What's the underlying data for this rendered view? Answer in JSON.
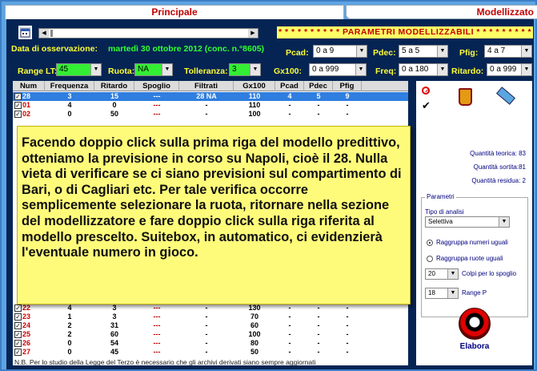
{
  "tabs": {
    "principale": "Principale",
    "modellizzato": "Modellizzato"
  },
  "header": {
    "param_title": "* * * * * * * * * * PARAMETRI MODELLIZZABILI * * * * * * * * *",
    "date_label": "Data di osservazione:",
    "date_value": "martedì 30 ottobre 2012 (conc. n.°8605)"
  },
  "controls": {
    "pcad": {
      "label": "Pcad:",
      "value": "0 a 9"
    },
    "pdec": {
      "label": "Pdec:",
      "value": "5 a 5"
    },
    "pfig": {
      "label": "Pfig:",
      "value": "4 a 7"
    },
    "range_lt": {
      "label": "Range LT:",
      "value": "45"
    },
    "ruota": {
      "label": "Ruota:",
      "value": "NA"
    },
    "tolleranza": {
      "label": "Tolleranza:",
      "value": "3"
    },
    "gx100": {
      "label": "Gx100:",
      "value": "0 a 999"
    },
    "freq": {
      "label": "Freq:",
      "value": "0 a 180"
    },
    "ritardo": {
      "label": "Ritardo:",
      "value": "0 a 999"
    }
  },
  "table": {
    "columns": [
      "Num",
      "Frequenza",
      "Ritardo",
      "Spoglio",
      "Filtrati",
      "Gx100",
      "Pcad",
      "Pdec",
      "Pfig"
    ],
    "top_rows": [
      {
        "num": "28",
        "freq": "3",
        "rit": "15",
        "spoglio": "---",
        "filtrati": "28 NA",
        "gx": "110",
        "pcad": "4",
        "pdec": "5",
        "pfig": "9",
        "selected": true
      },
      {
        "num": "01",
        "freq": "4",
        "rit": "0",
        "spoglio": "---",
        "filtrati": "-",
        "gx": "110",
        "pcad": "-",
        "pdec": "-",
        "pfig": "-",
        "selected": false
      },
      {
        "num": "02",
        "freq": "0",
        "rit": "50",
        "spoglio": "---",
        "filtrati": "-",
        "gx": "100",
        "pcad": "-",
        "pdec": "-",
        "pfig": "-",
        "selected": false
      }
    ],
    "bottom_rows": [
      {
        "num": "22",
        "freq": "4",
        "rit": "3",
        "spoglio": "---",
        "filtrati": "-",
        "gx": "130",
        "pcad": "-",
        "pdec": "-",
        "pfig": "-"
      },
      {
        "num": "23",
        "freq": "1",
        "rit": "3",
        "spoglio": "---",
        "filtrati": "-",
        "gx": "70",
        "pcad": "-",
        "pdec": "-",
        "pfig": "-"
      },
      {
        "num": "24",
        "freq": "2",
        "rit": "31",
        "spoglio": "---",
        "filtrati": "-",
        "gx": "60",
        "pcad": "-",
        "pdec": "-",
        "pfig": "-"
      },
      {
        "num": "25",
        "freq": "2",
        "rit": "60",
        "spoglio": "---",
        "filtrati": "-",
        "gx": "100",
        "pcad": "-",
        "pdec": "-",
        "pfig": "-"
      },
      {
        "num": "26",
        "freq": "0",
        "rit": "54",
        "spoglio": "---",
        "filtrati": "-",
        "gx": "80",
        "pcad": "-",
        "pdec": "-",
        "pfig": "-"
      },
      {
        "num": "27",
        "freq": "0",
        "rit": "45",
        "spoglio": "---",
        "filtrati": "-",
        "gx": "50",
        "pcad": "-",
        "pdec": "-",
        "pfig": "-"
      }
    ]
  },
  "right_panel": {
    "quantita_teorica": "Quantità teorica: 83",
    "quantita_sortita": "Quantità sortita:81",
    "quantita_residua": "Quantità residua: 2",
    "parametri_label": "Parametri",
    "tipo_analisi_label": "Tipo di analisi",
    "tipo_analisi_value": "Selettiva",
    "radio_numeri": "Raggruppa numeri uguali",
    "radio_ruote": "Raggruppa ruote uguali",
    "colpi_value": "20",
    "colpi_label": "Colpi per lo spoglio",
    "range_p_value": "18",
    "range_p_label": "Range P",
    "elabora_label": "Elabora"
  },
  "callout_text": "Facendo doppio click sulla prima riga del modello predittivo, otteniamo la previsione in corso su Napoli, cioè il 28. Nulla vieta di verificare se ci siano previsioni sul compartimento di Bari, o di Cagliari etc. Per tale verifica occorre semplicemente selezionare la ruota, ritornare nella sezione del modellizzatore e fare doppio click sulla riga riferita al modello prescelto. Suitebox, in automatico, ci evidenzierà l'eventuale numero in gioco.",
  "footer": "N.B. Per lo studio della Legge del Terzo è necessario che gli archivi derivati siano sempre aggiornati"
}
